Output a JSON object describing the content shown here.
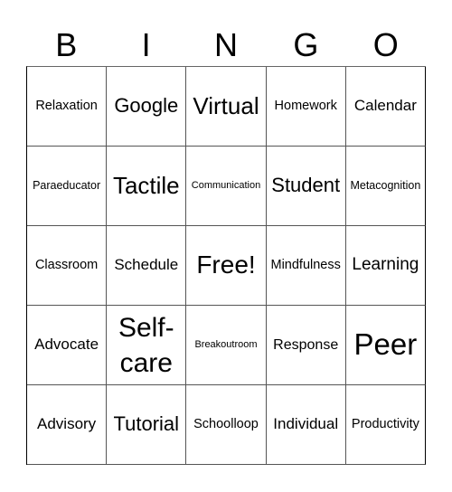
{
  "header": [
    "B",
    "I",
    "N",
    "G",
    "O"
  ],
  "cells": [
    [
      "Relaxation",
      "Google",
      "Virtual",
      "Homework",
      "Calendar"
    ],
    [
      "Paraeducator",
      "Tactile",
      "Communication",
      "Student",
      "Metacognition"
    ],
    [
      "Classroom",
      "Schedule",
      "Free!",
      "Mindfulness",
      "Learning"
    ],
    [
      "Advocate",
      "Self-care",
      "Breakoutroom",
      "Response",
      "Peer"
    ],
    [
      "Advisory",
      "Tutorial",
      "Schoolloop",
      "Individual",
      "Productivity"
    ]
  ]
}
